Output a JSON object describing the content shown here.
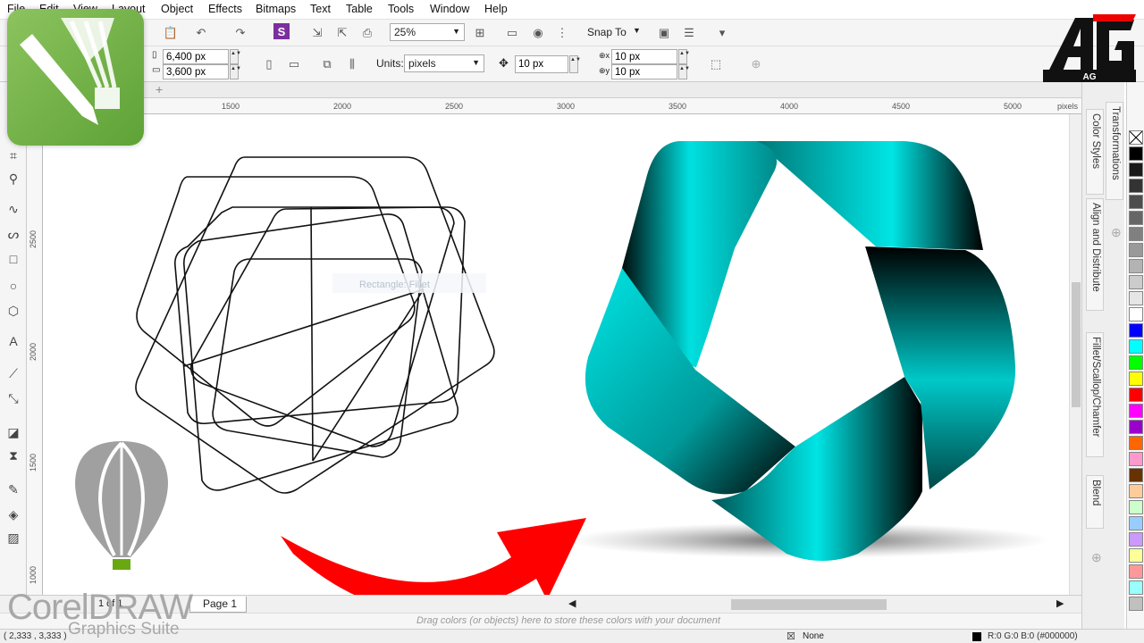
{
  "menu": [
    "File",
    "Edit",
    "View",
    "Layout",
    "Object",
    "Effects",
    "Bitmaps",
    "Text",
    "Table",
    "Tools",
    "Window",
    "Help"
  ],
  "toolbar": {
    "zoom_level": "25%",
    "snap_to_label": "Snap To"
  },
  "property_bar": {
    "page_width": "6,400 px",
    "page_height": "3,600 px",
    "units_label": "Units:",
    "units_value": "pixels",
    "nudge": "10 px",
    "duplicate_x": "10 px",
    "duplicate_y": "10 px"
  },
  "ruler": {
    "h_ticks": [
      "1500",
      "2000",
      "2500",
      "3000",
      "3500",
      "4000",
      "4500",
      "5000"
    ],
    "h_unit": "pixels",
    "v_ticks": [
      "2500",
      "2000",
      "1500",
      "1000"
    ]
  },
  "page_nav": {
    "page_count": "1 of 1",
    "page_tab": "Page 1"
  },
  "color_dock_hint": "Drag colors (or objects) here to store these colors with your document",
  "status": {
    "coords": "( 2,333 , 3,333 )",
    "fill_info": "R:0 G:0 B:0 (#000000)",
    "outline_label": "None"
  },
  "dockers": [
    "Transformations",
    "Color Styles",
    "Align and Distribute",
    "Fillet/Scallop/Chamfer",
    "Blend"
  ],
  "palette": [
    "#ffffff",
    "#000000",
    "#1a1a1a",
    "#333333",
    "#4d4d4d",
    "#666666",
    "#808080",
    "#999999",
    "#b3b3b3",
    "#cccccc",
    "#e6e6e6",
    "#ffffff",
    "#0000ff",
    "#00ffff",
    "#00ff00",
    "#ffff00",
    "#ff0000",
    "#ff00ff",
    "#9900cc",
    "#ff6600",
    "#ff99cc",
    "#663300",
    "#ffcc99",
    "#ccffcc",
    "#99ccff",
    "#cc99ff",
    "#ffff99",
    "#ff9999",
    "#99ffff",
    "#c0c0c0"
  ],
  "canvas_tooltip": "Rectangle: Fillet",
  "branding": {
    "product": "CorelDRAW",
    "subtitle": "Graphics Suite",
    "channel_mark": "AG"
  },
  "colors": {
    "accent_teal": "#00e5e5",
    "arrow_red": "#ff0000",
    "corel_green": "#6db33f"
  }
}
